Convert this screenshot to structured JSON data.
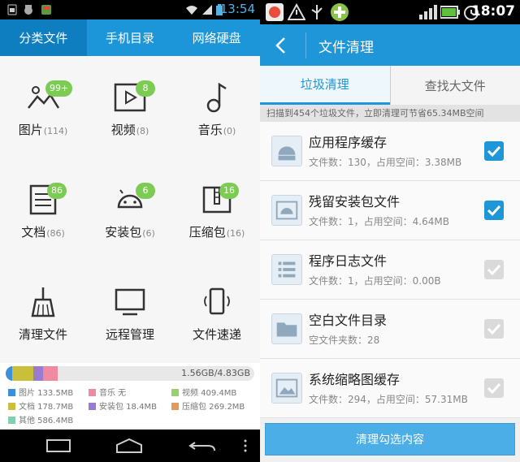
{
  "left": {
    "status": {
      "time": "13:54"
    },
    "tabs": [
      "分类文件",
      "手机目录",
      "网络硬盘"
    ],
    "categories": [
      {
        "label": "图片",
        "count": "(114)",
        "badge": "99+",
        "icon": "image-icon"
      },
      {
        "label": "视频",
        "count": "(8)",
        "badge": "8",
        "icon": "video-icon"
      },
      {
        "label": "音乐",
        "count": "(0)",
        "badge": "",
        "icon": "music-icon"
      },
      {
        "label": "文档",
        "count": "(86)",
        "badge": "86",
        "icon": "document-icon"
      },
      {
        "label": "安装包",
        "count": "(6)",
        "badge": "6",
        "icon": "android-icon"
      },
      {
        "label": "压缩包",
        "count": "(16)",
        "badge": "16",
        "icon": "zip-icon"
      },
      {
        "label": "清理文件",
        "count": "",
        "badge": "",
        "icon": "broom-icon"
      },
      {
        "label": "远程管理",
        "count": "",
        "badge": "",
        "icon": "monitor-icon"
      },
      {
        "label": "文件速递",
        "count": "",
        "badge": "",
        "icon": "phone-transfer-icon"
      }
    ],
    "storage": {
      "total": "1.56GB/4.83GB",
      "legend": [
        {
          "text": "图片 133.5MB",
          "color": "#3d8fdb"
        },
        {
          "text": "音乐 无",
          "color": "#ef8aa0"
        },
        {
          "text": "视频 409.4MB",
          "color": "#9bd06e"
        },
        {
          "text": "文档 178.7MB",
          "color": "#c9bf3a"
        },
        {
          "text": "安装包 18.4MB",
          "color": "#9b7bd0"
        },
        {
          "text": "压缩包 269.2MB",
          "color": "#e39a5a"
        },
        {
          "text": "其他 586.4MB",
          "color": "#7fd0b0"
        }
      ],
      "bar_fractions": [
        0.027,
        0.0,
        0.085,
        0.037,
        0.004,
        0.056
      ]
    }
  },
  "right": {
    "status": {
      "time": "18:07"
    },
    "title": "文件清理",
    "tabs": [
      "垃圾清理",
      "查找大文件"
    ],
    "scan_info": "扫描到454个垃圾文件，立即清理可节省65.34MB空间",
    "items": [
      {
        "title": "应用程序缓存",
        "sub": "文件数：130，占用空间：3.38MB",
        "checked": true,
        "icon": "android-app-icon"
      },
      {
        "title": "残留安装包文件",
        "sub": "文件数：1，占用空间：4.64MB",
        "checked": true,
        "icon": "android-package-icon"
      },
      {
        "title": "程序日志文件",
        "sub": "文件数：1，占用空间：0.00B",
        "checked": false,
        "icon": "log-list-icon"
      },
      {
        "title": "空白文件目录",
        "sub": "空文件夹数：28",
        "checked": false,
        "icon": "folder-icon"
      },
      {
        "title": "系统缩略图缓存",
        "sub": "文件数：294，占用空间：57.31MB",
        "checked": false,
        "icon": "thumbnail-icon"
      }
    ],
    "button": "清理勾选内容",
    "accent": "#1e96d8"
  }
}
